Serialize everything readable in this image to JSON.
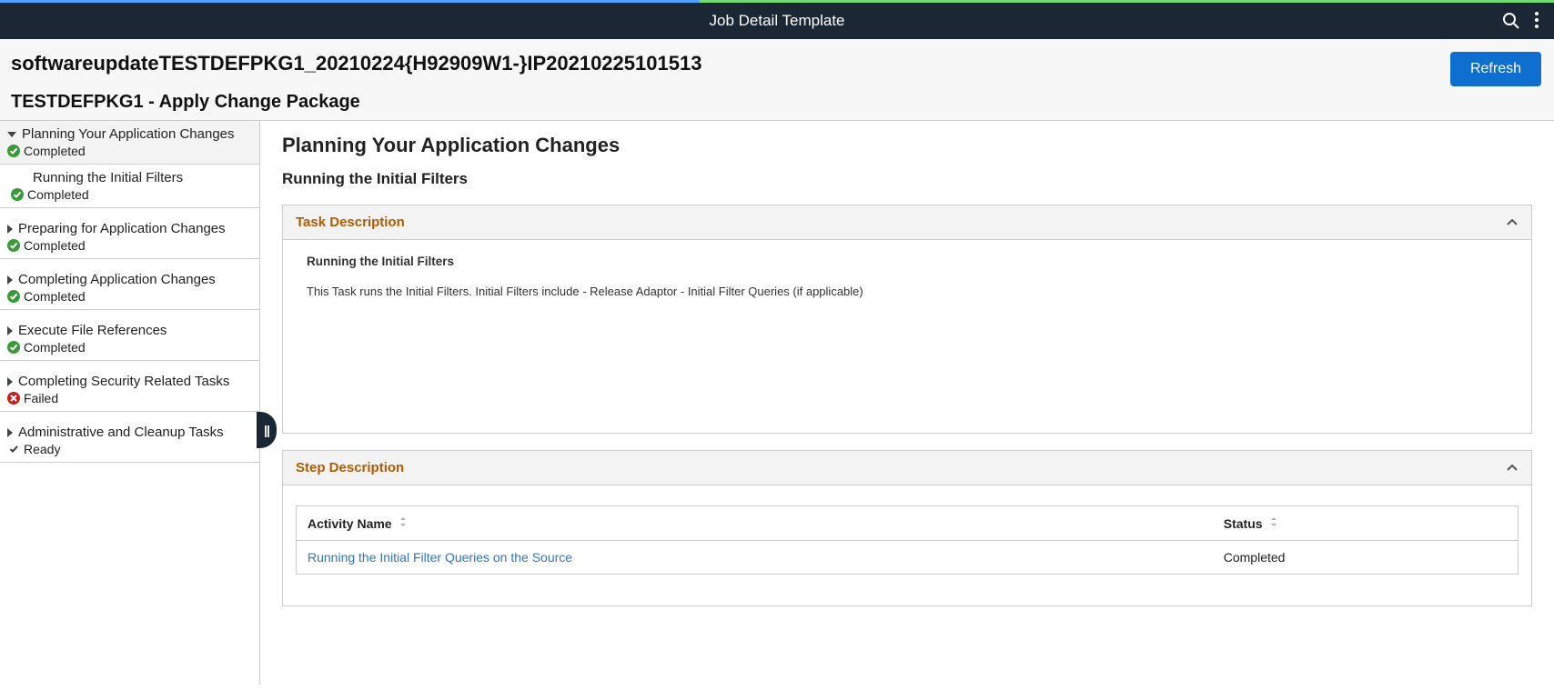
{
  "topbar": {
    "title": "Job Detail Template"
  },
  "header": {
    "job_name": "softwareupdateTESTDEFPKG1_20210224{H92909W1-}IP20210225101513",
    "job_subtitle": "TESTDEFPKG1 - Apply Change Package",
    "refresh_label": "Refresh"
  },
  "sidebar": {
    "items": [
      {
        "label": "Planning Your Application Changes",
        "status": "Completed",
        "status_type": "completed",
        "expanded": true
      },
      {
        "label": "Running the Initial Filters",
        "status": "Completed",
        "status_type": "completed",
        "child": true
      },
      {
        "label": "Preparing for Application Changes",
        "status": "Completed",
        "status_type": "completed",
        "expanded": false
      },
      {
        "label": "Completing Application Changes",
        "status": "Completed",
        "status_type": "completed",
        "expanded": false
      },
      {
        "label": "Execute File References",
        "status": "Completed",
        "status_type": "completed",
        "expanded": false
      },
      {
        "label": "Completing Security Related Tasks",
        "status": "Failed",
        "status_type": "failed",
        "expanded": false
      },
      {
        "label": "Administrative and Cleanup Tasks",
        "status": "Ready",
        "status_type": "ready",
        "expanded": false
      }
    ]
  },
  "main": {
    "heading": "Planning Your Application Changes",
    "subheading": "Running the Initial Filters",
    "task_description_label": "Task Description",
    "task": {
      "name": "Running the Initial Filters",
      "description": "This Task runs the Initial Filters. Initial Filters include - Release Adaptor - Initial Filter Queries (if applicable)"
    },
    "step_description_label": "Step Description",
    "step_table": {
      "headers": {
        "activity_name": "Activity Name",
        "status": "Status"
      },
      "rows": [
        {
          "activity_name": "Running the Initial Filter Queries on the Source",
          "status": "Completed"
        }
      ]
    }
  }
}
